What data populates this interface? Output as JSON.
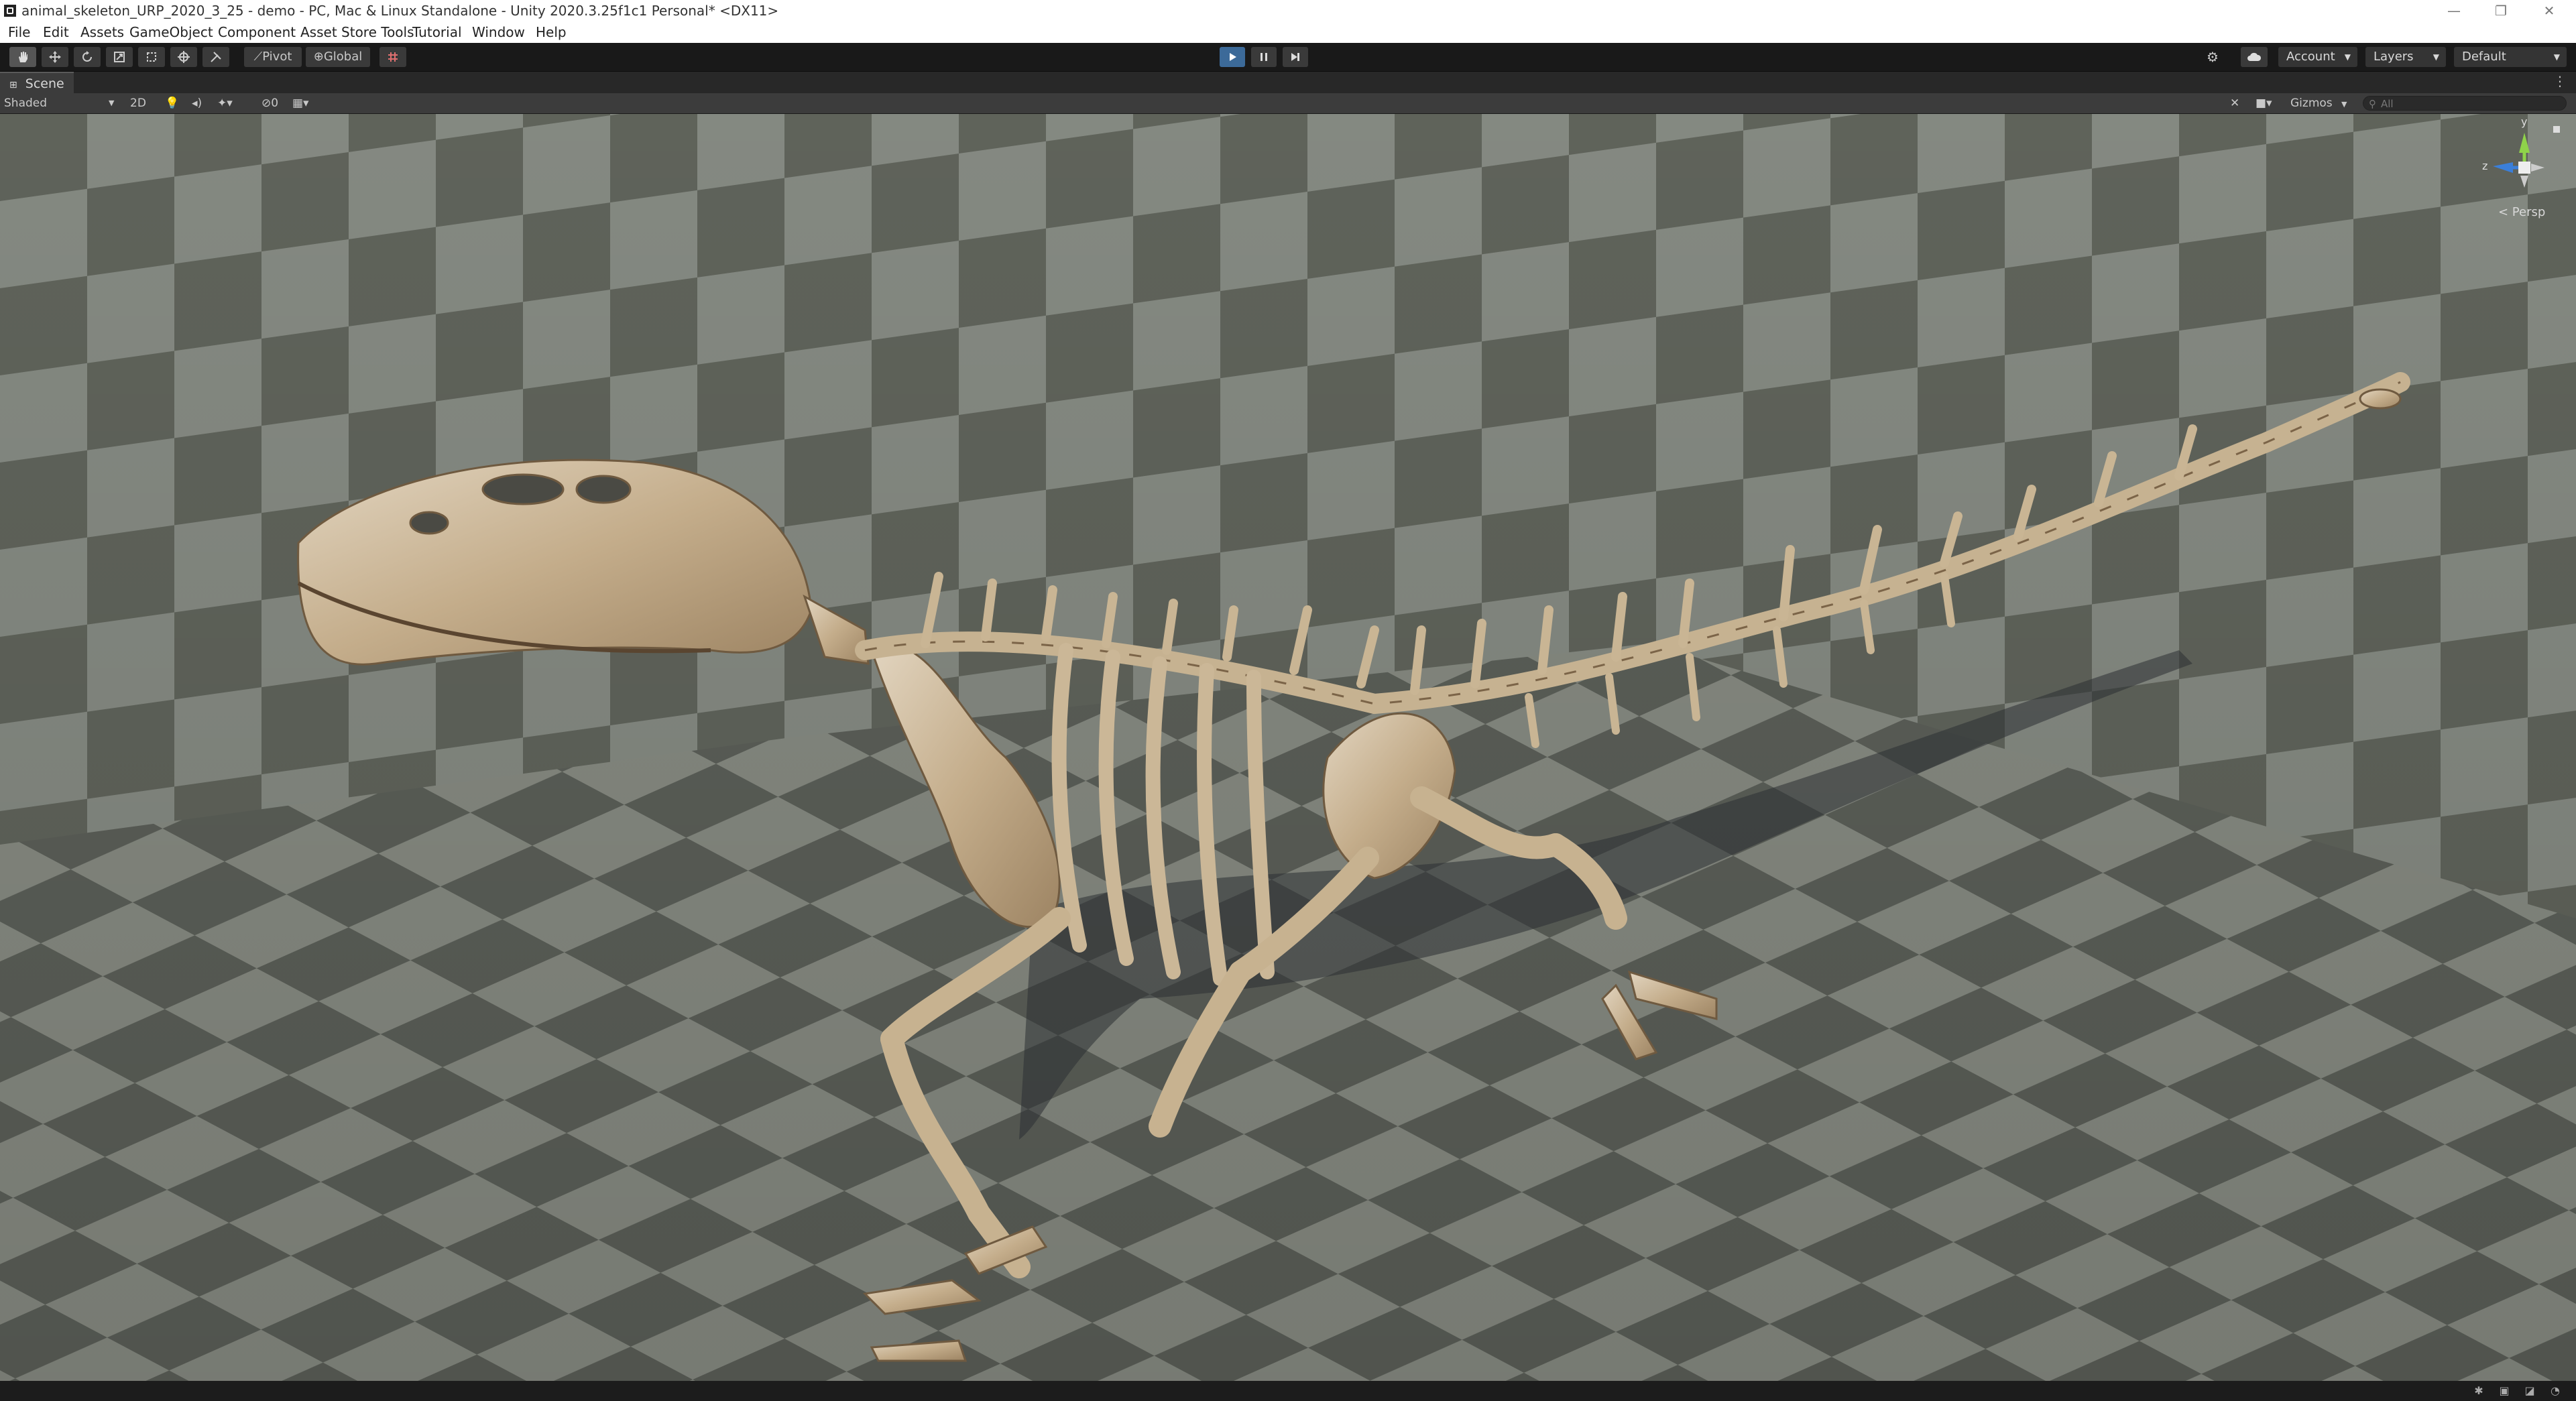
{
  "window": {
    "title": "animal_skeleton_URP_2020_3_25 - demo - PC, Mac & Linux Standalone - Unity 2020.3.25f1c1 Personal* <DX11>",
    "minimize": "—",
    "restore": "❐",
    "close": "✕"
  },
  "menu": {
    "items": [
      "File",
      "Edit",
      "Assets",
      "GameObject",
      "Component",
      "Asset Store Tools",
      "Tutorial",
      "Window",
      "Help"
    ]
  },
  "toolbar": {
    "pivot_label": "Pivot",
    "global_label": "Global",
    "account_label": "Account",
    "layers_label": "Layers",
    "layout_label": "Default"
  },
  "scene": {
    "tab_label": "Scene",
    "shading_mode": "Shaded",
    "mode_2d": "2D",
    "hidden_count": "0",
    "gizmos_label": "Gizmos",
    "search_placeholder": "All",
    "projection_label": "< Persp",
    "gizmo_axes": {
      "y": "y",
      "z": "z"
    }
  },
  "colors": {
    "checker_light": "#8a8f86",
    "checker_dark": "#62665f",
    "bone": "#cdbb9f",
    "play_active": "#3c6a99"
  }
}
